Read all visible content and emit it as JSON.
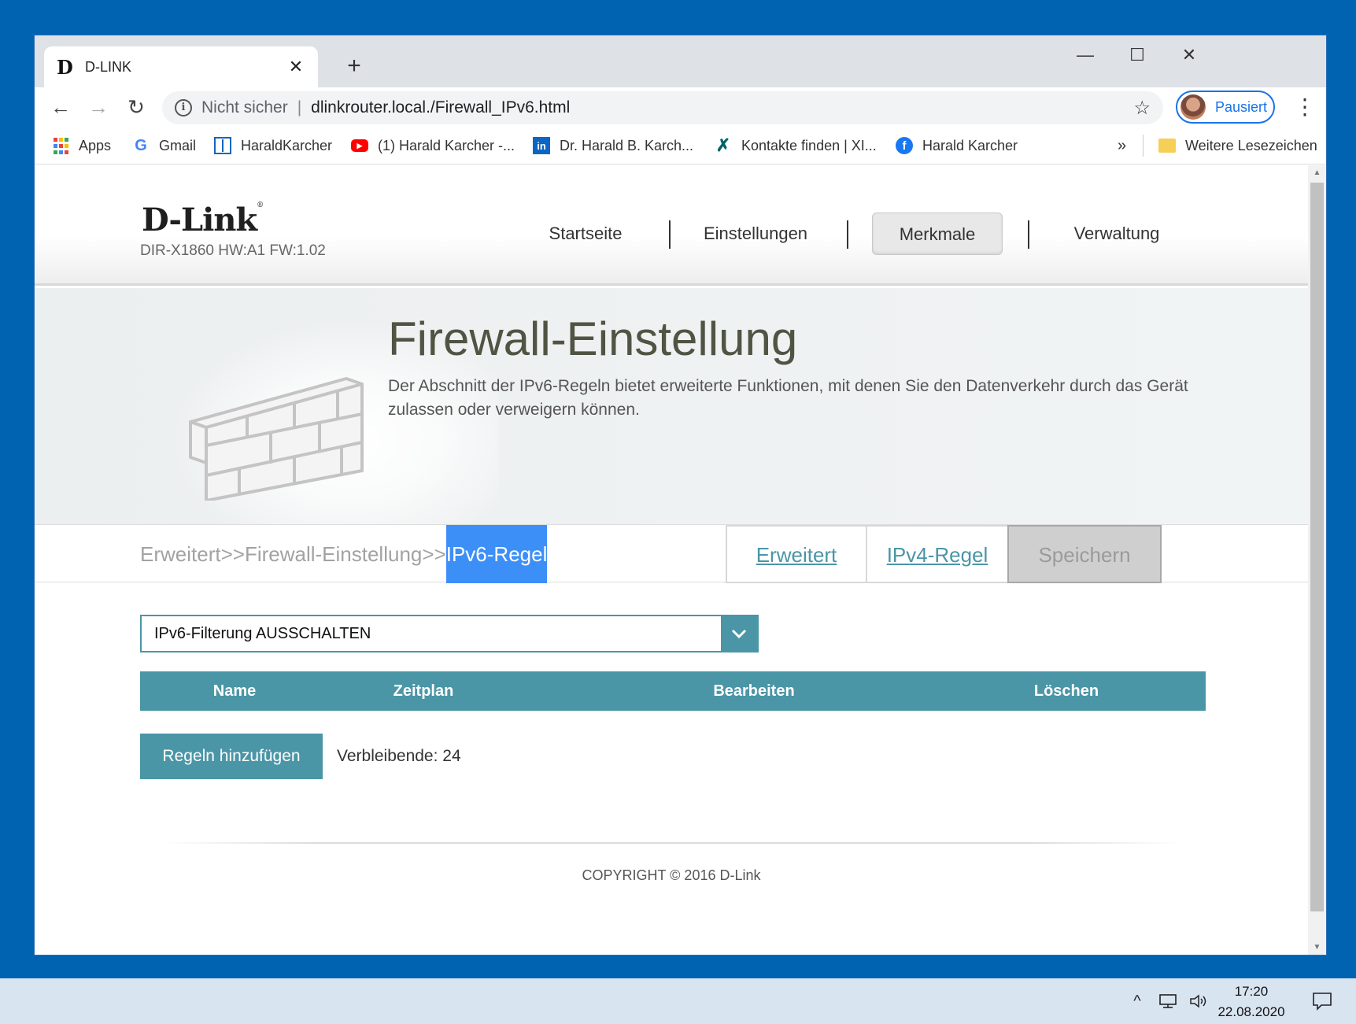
{
  "browser": {
    "tab_title": "D-LINK",
    "tab_favicon": "D",
    "new_tab": "+",
    "omnibox": {
      "security": "Nicht sicher",
      "url": "dlinkrouter.local./Firewall_IPv6.html"
    },
    "profile_status": "Pausiert",
    "bookmarks": [
      {
        "label": "Apps",
        "icon": "apps-icon"
      },
      {
        "label": "Gmail",
        "icon": "google-icon"
      },
      {
        "label": "HaraldKarcher",
        "icon": "site-icon"
      },
      {
        "label": "(1) Harald Karcher -...",
        "icon": "youtube-icon"
      },
      {
        "label": "Dr. Harald B. Karch...",
        "icon": "linkedin-icon"
      },
      {
        "label": "Kontakte finden | XI...",
        "icon": "xing-icon"
      },
      {
        "label": "Harald Karcher",
        "icon": "facebook-icon"
      }
    ],
    "bookmarks_overflow": "»",
    "other_bookmarks": "Weitere Lesezeichen"
  },
  "router": {
    "logo": "D-Link",
    "model": "DIR-X1860 HW:A1 FW:1.02",
    "nav": [
      "Startseite",
      "Einstellungen",
      "Merkmale",
      "Verwaltung"
    ],
    "active_nav": "Merkmale",
    "page_title": "Firewall-Einstellung",
    "page_description": "Der Abschnitt der IPv6-Regeln bietet erweiterte Funktionen, mit denen Sie den Datenverkehr durch das Gerät zulassen oder verweigern können.",
    "breadcrumb_prefix": "Erweitert>>Firewall-Einstellung>>",
    "breadcrumb_current": "IPv6-Regel",
    "sub_buttons": {
      "advanced": "Erweitert",
      "ipv4": "IPv4-Regel",
      "save": "Speichern"
    },
    "filter_select": "IPv6-Filterung AUSSCHALTEN",
    "table_headers": [
      "Name",
      "Zeitplan",
      "Bearbeiten",
      "Löschen"
    ],
    "add_button": "Regeln hinzufügen",
    "remaining": "Verbleibende: 24",
    "copyright": "COPYRIGHT © 2016 D-Link"
  },
  "taskbar": {
    "time": "17:20",
    "date": "22.08.2020"
  },
  "colors": {
    "desktop": "#0063b1",
    "accent_teal": "#4a96a6",
    "breadcrumb_highlight": "#3d8ff8",
    "title_text": "#4f5443"
  }
}
